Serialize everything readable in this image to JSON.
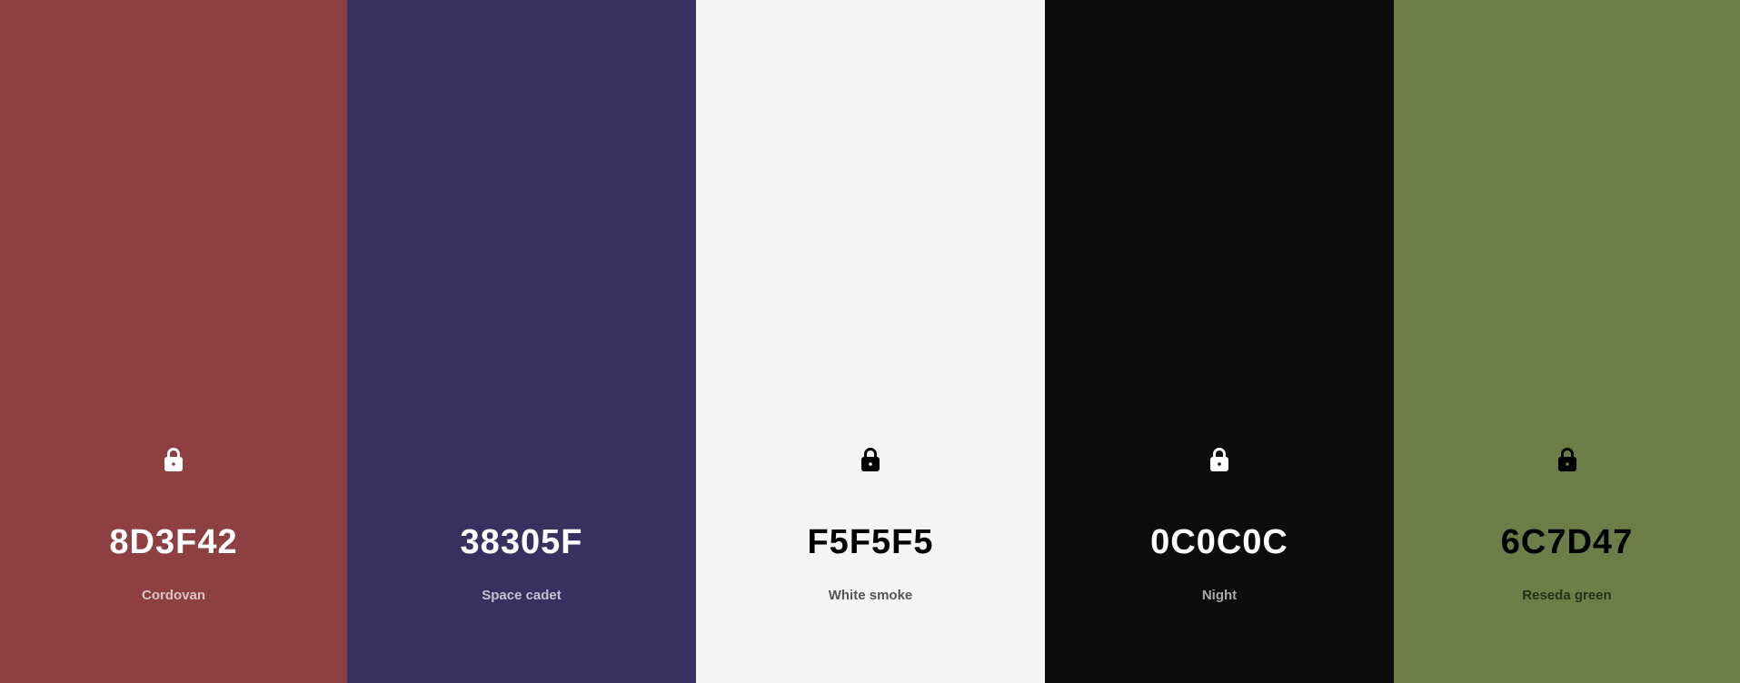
{
  "palette": {
    "swatches": [
      {
        "hex": "8D3F42",
        "name": "Cordovan",
        "color": "#8D3F42",
        "text_color": "#FFFFFF",
        "name_color": "#D8C4C5",
        "icon": "lock-icon"
      },
      {
        "hex": "38305F",
        "name": "Space cadet",
        "color": "#38305F",
        "text_color": "#FFFFFF",
        "name_color": "#C4C1D0",
        "icon": "lock-icon"
      },
      {
        "hex": "F5F5F5",
        "name": "White smoke",
        "color": "#F5F5F5",
        "text_color": "#000000",
        "name_color": "#555555",
        "icon": "lock-icon"
      },
      {
        "hex": "0C0C0C",
        "name": "Night",
        "color": "#0C0C0C",
        "text_color": "#FFFFFF",
        "name_color": "#AAAAAA",
        "icon": "lock-icon"
      },
      {
        "hex": "6C7D47",
        "name": "Reseda green",
        "color": "#6C7D47",
        "text_color": "#000000",
        "name_color": "#2A3018",
        "icon": "lock-icon"
      }
    ]
  }
}
